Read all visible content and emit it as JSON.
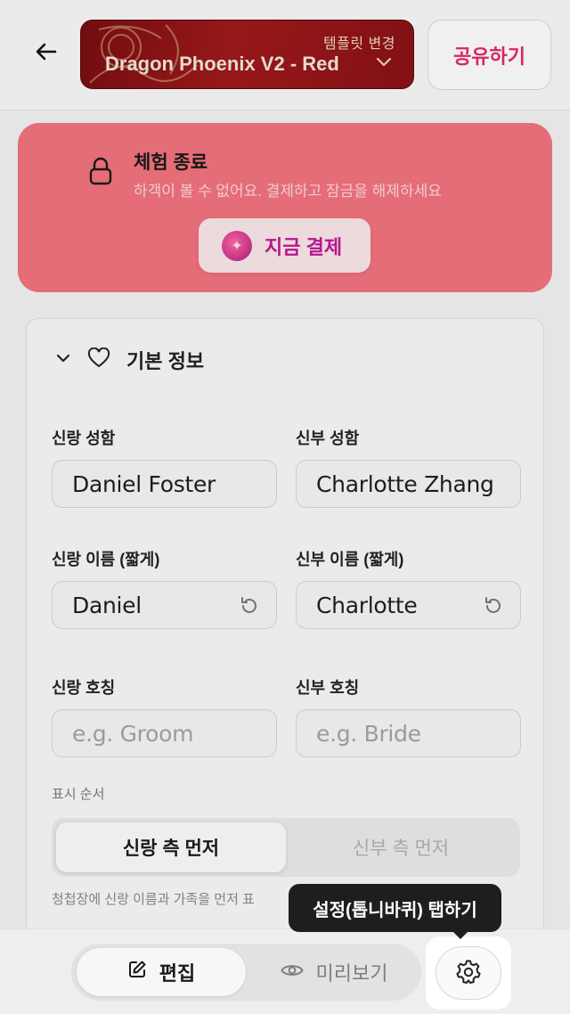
{
  "header": {
    "back_icon": "arrow-left-icon",
    "template": {
      "change_label": "템플릿 변경",
      "name": "Dragon Phoenix V2 - Red",
      "chevron_icon": "chevron-down-icon"
    },
    "share_label": "공유하기",
    "colors": {
      "share_text": "#e7296a",
      "template_bg": "#8a1216"
    }
  },
  "trial_banner": {
    "lock_icon": "lock-icon",
    "title": "체험 종료",
    "message": "하객이 볼 수 없어요. 결제하고 잠금을 해제하세요",
    "pay_label": "지금 결제",
    "pay_icon": "sparkle-icon",
    "colors": {
      "background": "#f47480",
      "pay_text": "#c2189a"
    }
  },
  "form": {
    "section": {
      "collapse_icon": "chevron-down-icon",
      "heart_icon": "heart-icon",
      "title": "기본 정보"
    },
    "groom_full_name": {
      "label": "신랑 성함",
      "value": "Daniel Foster"
    },
    "bride_full_name": {
      "label": "신부 성함",
      "value": "Charlotte Zhang"
    },
    "groom_short_name": {
      "label": "신랑 이름 (짧게)",
      "value": "Daniel",
      "reset_icon": "reset-icon"
    },
    "bride_short_name": {
      "label": "신부 이름 (짧게)",
      "value": "Charlotte",
      "reset_icon": "reset-icon"
    },
    "groom_title": {
      "label": "신랑 호칭",
      "placeholder": "e.g. Groom"
    },
    "bride_title": {
      "label": "신부 호칭",
      "placeholder": "e.g. Bride"
    },
    "display_order": {
      "label": "표시 순서",
      "options": [
        "신랑 측 먼저",
        "신부 측 먼저"
      ],
      "selected": "신랑 측 먼저",
      "hint": "청첩장에 신랑 이름과 가족을 먼저 표"
    }
  },
  "bottom_bar": {
    "edit_label": "편집",
    "edit_icon": "pencil-icon",
    "preview_label": "미리보기",
    "preview_icon": "eye-icon",
    "settings_icon": "gear-icon"
  },
  "tooltip": {
    "text": "설정(톱니바퀴) 탭하기"
  }
}
